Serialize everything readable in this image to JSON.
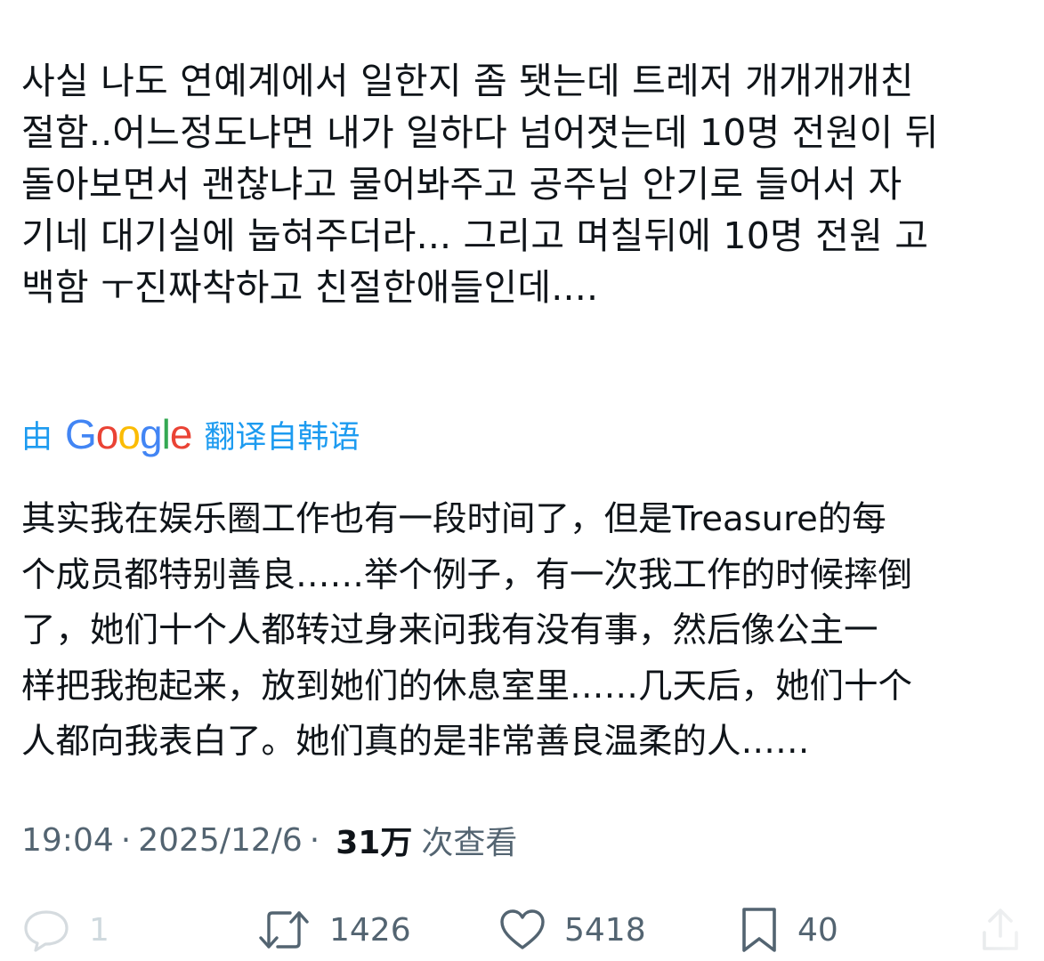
{
  "tweet": {
    "original_text": "사실 나도 연예계에서 일한지 좀 됏는데 트레저 개개개개친\n절함..어느정도냐면 내가 일하다 넘어졋는데 10명 전원이 뒤\n돌아보면서 괜찮냐고 물어봐주고 공주님 안기로 들어서 자\n기네 대기실에 눕혀주더라... 그리고 며칠뒤에 10명 전원 고\n백함 ㅜ진짜착하고 친절한애들인데....",
    "translation": {
      "prefix": "由",
      "brand": "Google",
      "suffix": "翻译自韩语"
    },
    "translated_text": "其实我在娱乐圈工作也有一段时间了，但是Treasure的每\n个成员都特别善良……举个例子，有一次我工作的时候摔倒\n了，她们十个人都转过身来问我有没有事，然后像公主一\n样把我抱起来，放到她们的休息室里……几天后，她们十个\n人都向我表白了。她们真的是非常善良温柔的人……",
    "time": "19:04",
    "date": "2025/12/6",
    "separator": "·",
    "views_count": "31万",
    "views_label": "次查看"
  },
  "actions": {
    "reply": {
      "icon": "reply-bubble-icon",
      "count": "1"
    },
    "retweet": {
      "icon": "retweet-icon",
      "count": "1426"
    },
    "like": {
      "icon": "heart-icon",
      "count": "5418"
    },
    "bookmark": {
      "icon": "bookmark-icon",
      "count": "40"
    },
    "share": {
      "icon": "share-icon"
    }
  },
  "colors": {
    "text": "#0f1419",
    "secondary": "#536471",
    "link": "#1d9bf0",
    "google_blue": "#4285F4",
    "google_red": "#EA4335",
    "google_yellow": "#FBBC05",
    "google_green": "#34A853"
  }
}
